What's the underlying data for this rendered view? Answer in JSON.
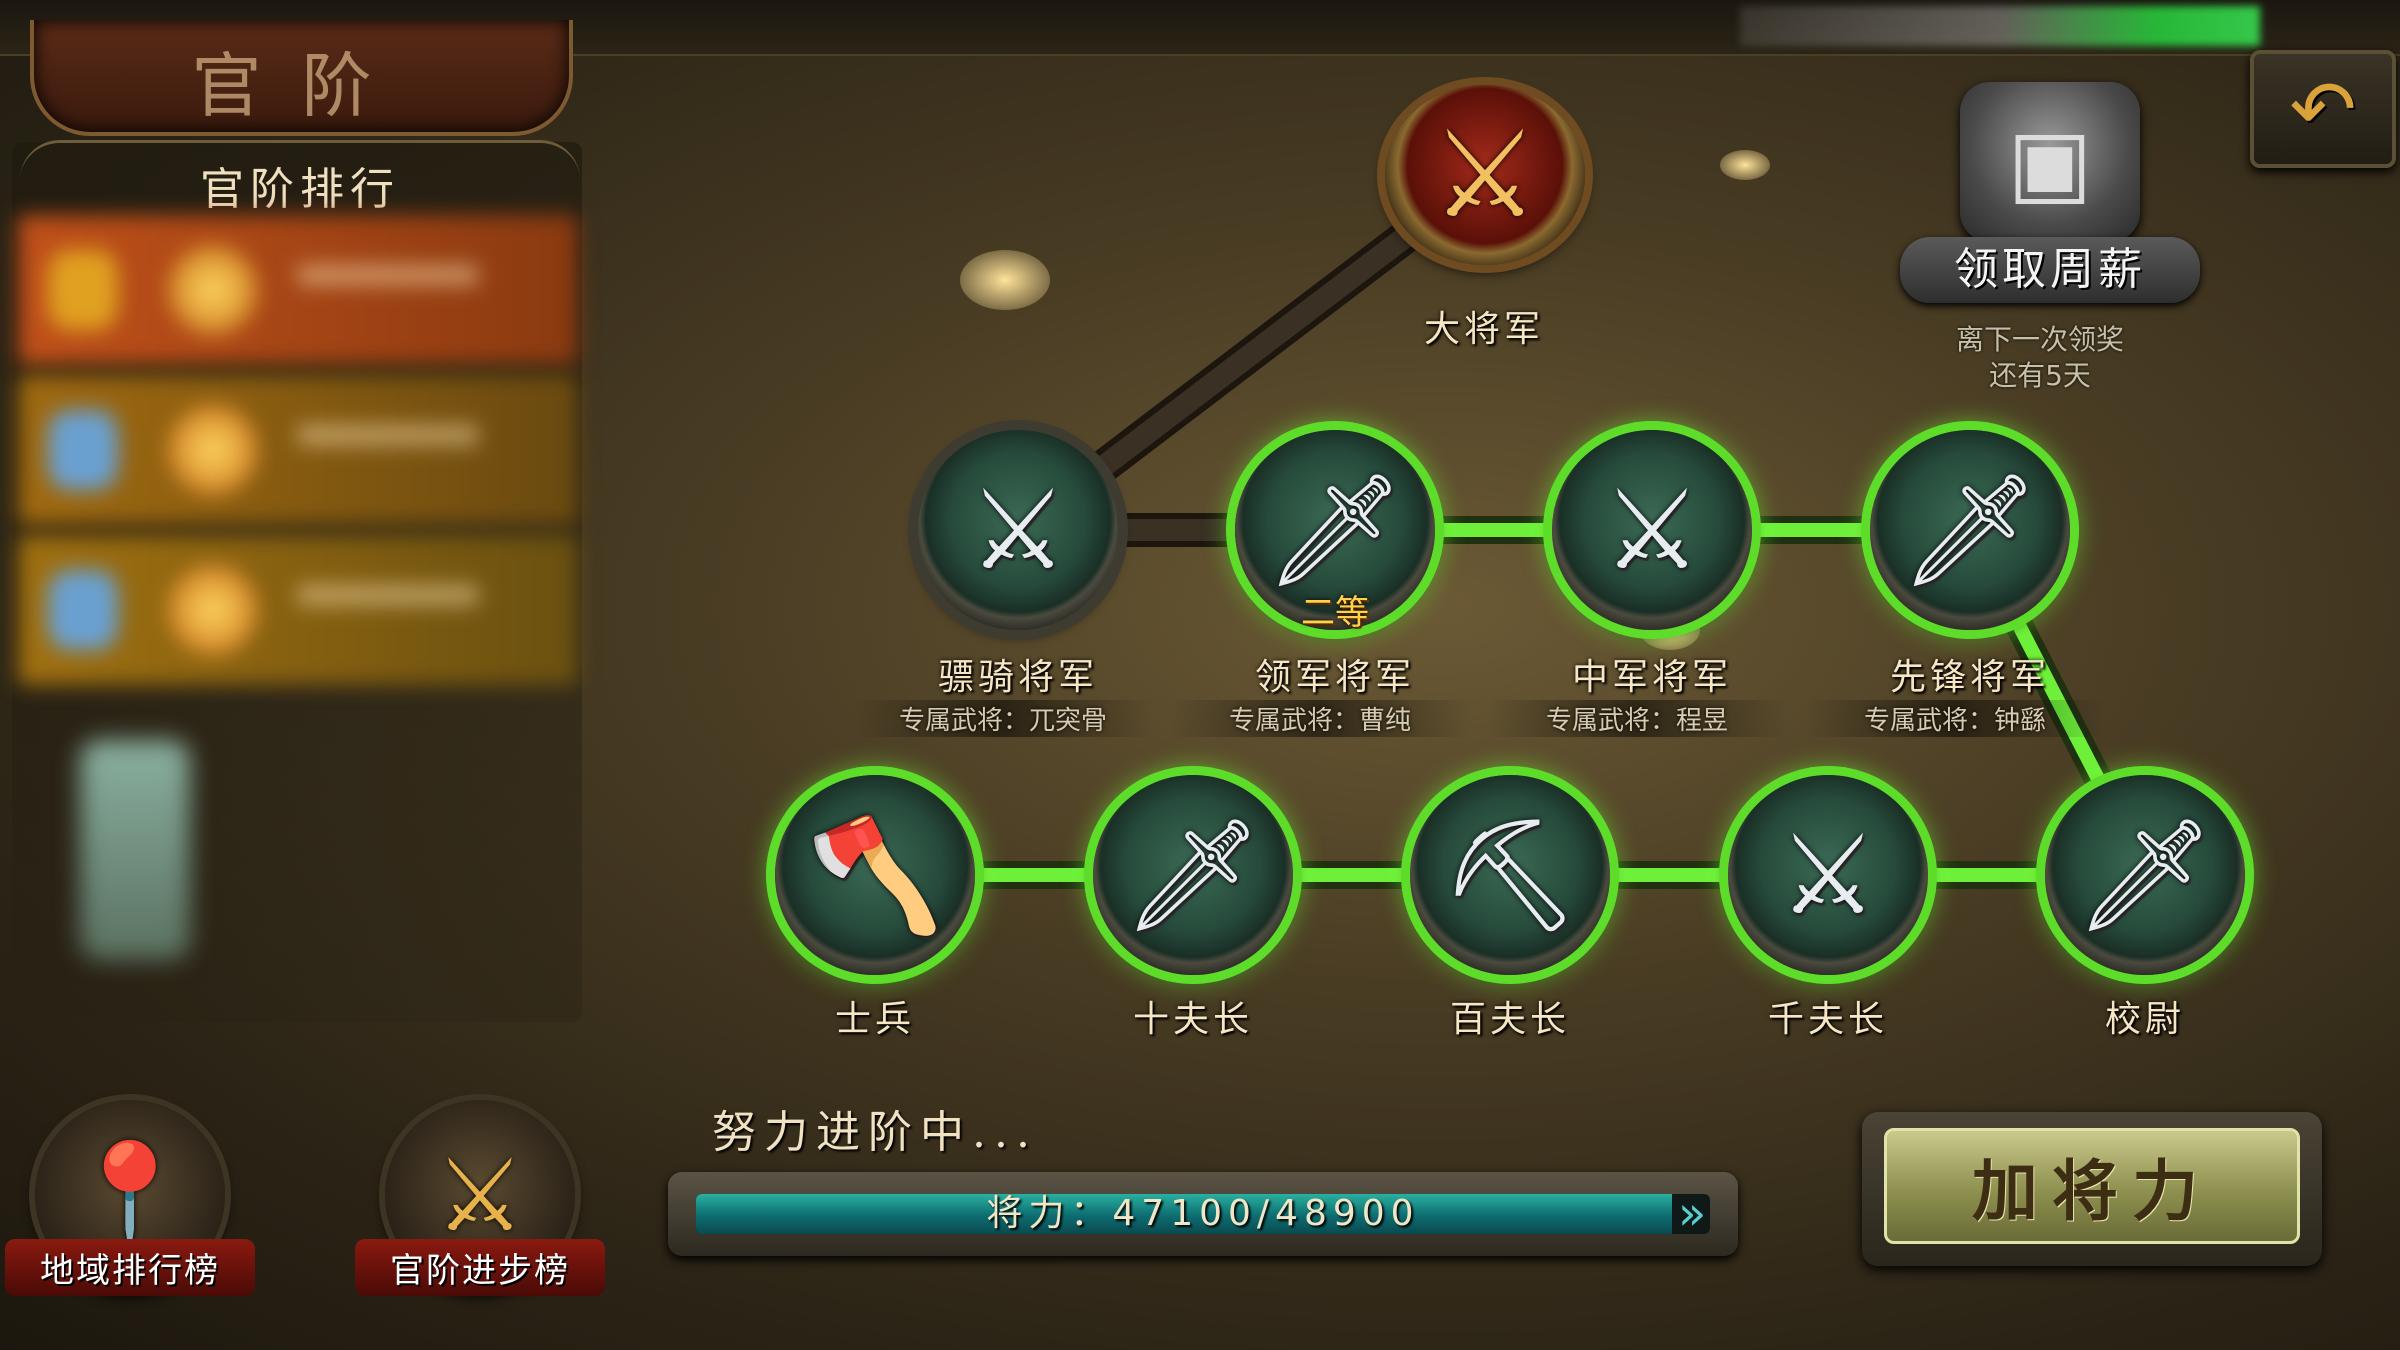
{
  "header": {
    "title": "官阶"
  },
  "rank_panel": {
    "title": "官阶排行"
  },
  "top_rank": {
    "name": "大将军"
  },
  "generals": [
    {
      "name": "骠骑将军",
      "sub": "专属武将：兀突骨",
      "glyph": "⚔"
    },
    {
      "name": "领军将军",
      "sub": "专属武将：曹纯",
      "glyph": "🗡"
    },
    {
      "name": "中军将军",
      "sub": "专属武将：程昱",
      "glyph": "⚔"
    },
    {
      "name": "先锋将军",
      "sub": "专属武将：钟繇",
      "glyph": "🗡"
    }
  ],
  "grade_badge": "二等",
  "ranks": [
    {
      "name": "士兵",
      "icon": "axe-icon"
    },
    {
      "name": "十夫长",
      "icon": "dagger-icon"
    },
    {
      "name": "百夫长",
      "icon": "halberd-icon"
    },
    {
      "name": "千夫长",
      "icon": "sabre-icon"
    },
    {
      "name": "校尉",
      "icon": "glaive-icon"
    }
  ],
  "weekly_salary": {
    "label": "领取周薪",
    "note_line1": "离下一次领奖",
    "note_line2": "还有5天"
  },
  "buttons": {
    "region_rank": "地域排行榜",
    "progress_rank": "官阶进步榜",
    "add_power": "加将力"
  },
  "progress": {
    "status": "努力进阶中...",
    "label": "将力：47100/48900",
    "current": 47100,
    "max": 48900,
    "fraction": 0.963
  },
  "colors": {
    "lit_path": "#5ddd2a",
    "dim_path": "#2a241a",
    "bar_fill": "#1a8f8a"
  }
}
